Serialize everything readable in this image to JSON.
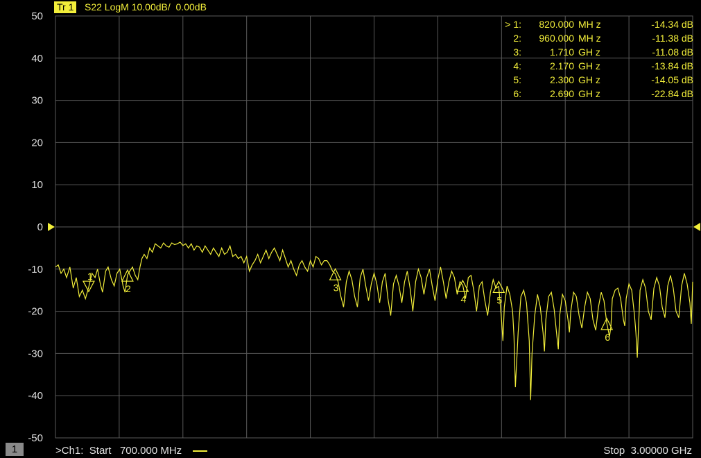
{
  "header": {
    "trace_badge": "Tr 1",
    "trace_title": "S22 LogM 10.00dB/  0.00dB"
  },
  "colors": {
    "trace": "#f2ee3a",
    "grid": "#5a5a5a",
    "background": "#000000",
    "channel_badge": "#8a8a8a"
  },
  "markers": [
    {
      "label": "> 1:",
      "freq": "820.000",
      "unit": "MH z",
      "value": "-14.34 dB",
      "num": "1",
      "x_ghz": 0.82,
      "y_db": -14.34
    },
    {
      "label": "2:",
      "freq": "960.000",
      "unit": "MH z",
      "value": "-11.38 dB",
      "num": "2",
      "x_ghz": 0.96,
      "y_db": -11.38
    },
    {
      "label": "3:",
      "freq": "1.710",
      "unit": "GH z",
      "value": "-11.08 dB",
      "num": "3",
      "x_ghz": 1.71,
      "y_db": -11.08
    },
    {
      "label": "4:",
      "freq": "2.170",
      "unit": "GH z",
      "value": "-13.84 dB",
      "num": "4",
      "x_ghz": 2.17,
      "y_db": -13.84
    },
    {
      "label": "5:",
      "freq": "2.300",
      "unit": "GH z",
      "value": "-14.05 dB",
      "num": "5",
      "x_ghz": 2.3,
      "y_db": -14.05
    },
    {
      "label": "6:",
      "freq": "2.690",
      "unit": "GH z",
      "value": "-22.84 dB",
      "num": "6",
      "x_ghz": 2.69,
      "y_db": -22.84
    }
  ],
  "footer": {
    "channel_number": "1",
    "start_label": ">Ch1:  Start   700.000 MHz",
    "stop_label": "Stop  3.00000 GHz"
  },
  "chart_data": {
    "type": "line",
    "xlim": [
      0.7,
      3.0
    ],
    "ylim": [
      -50,
      50
    ],
    "y_ticks": [
      "50",
      "40",
      "30",
      "20",
      "10",
      "0",
      "-10",
      "-20",
      "-30",
      "-40",
      "-50"
    ],
    "y_tick_values": [
      50,
      40,
      30,
      20,
      10,
      0,
      -10,
      -20,
      -30,
      -40,
      -50
    ],
    "grid": true,
    "reference_level_db": 0,
    "series": [
      {
        "points": [
          [
            0.7,
            -9.5
          ],
          [
            0.71,
            -9.0
          ],
          [
            0.72,
            -11.0
          ],
          [
            0.73,
            -10.0
          ],
          [
            0.74,
            -12.0
          ],
          [
            0.752,
            -9.5
          ],
          [
            0.764,
            -14.5
          ],
          [
            0.775,
            -12.0
          ],
          [
            0.786,
            -16.5
          ],
          [
            0.797,
            -15.0
          ],
          [
            0.808,
            -17.0
          ],
          [
            0.82,
            -14.3
          ],
          [
            0.832,
            -11.0
          ],
          [
            0.843,
            -12.0
          ],
          [
            0.852,
            -10.0
          ],
          [
            0.862,
            -13.5
          ],
          [
            0.87,
            -15.5
          ],
          [
            0.881,
            -10.5
          ],
          [
            0.89,
            -9.5
          ],
          [
            0.902,
            -12.5
          ],
          [
            0.912,
            -14.0
          ],
          [
            0.922,
            -11.0
          ],
          [
            0.932,
            -10.0
          ],
          [
            0.944,
            -14.0
          ],
          [
            0.951,
            -15.5
          ],
          [
            0.96,
            -11.4
          ],
          [
            0.968,
            -10.5
          ],
          [
            0.978,
            -9.5
          ],
          [
            0.988,
            -11.5
          ],
          [
            0.997,
            -12.5
          ],
          [
            1.005,
            -9.5
          ],
          [
            1.012,
            -7.5
          ],
          [
            1.02,
            -6.5
          ],
          [
            1.03,
            -7.5
          ],
          [
            1.04,
            -5.0
          ],
          [
            1.05,
            -6.0
          ],
          [
            1.06,
            -4.0
          ],
          [
            1.07,
            -4.5
          ],
          [
            1.08,
            -5.0
          ],
          [
            1.09,
            -3.8
          ],
          [
            1.1,
            -4.5
          ],
          [
            1.11,
            -4.8
          ],
          [
            1.12,
            -3.8
          ],
          [
            1.13,
            -4.2
          ],
          [
            1.14,
            -4.0
          ],
          [
            1.15,
            -3.6
          ],
          [
            1.16,
            -4.4
          ],
          [
            1.17,
            -4.0
          ],
          [
            1.18,
            -5.0
          ],
          [
            1.19,
            -4.0
          ],
          [
            1.2,
            -5.5
          ],
          [
            1.21,
            -4.5
          ],
          [
            1.22,
            -4.8
          ],
          [
            1.23,
            -6.0
          ],
          [
            1.24,
            -4.5
          ],
          [
            1.25,
            -5.5
          ],
          [
            1.26,
            -6.5
          ],
          [
            1.27,
            -5.0
          ],
          [
            1.28,
            -6.0
          ],
          [
            1.29,
            -7.0
          ],
          [
            1.3,
            -5.0
          ],
          [
            1.31,
            -6.5
          ],
          [
            1.32,
            -6.0
          ],
          [
            1.33,
            -4.5
          ],
          [
            1.34,
            -7.0
          ],
          [
            1.35,
            -6.5
          ],
          [
            1.36,
            -7.5
          ],
          [
            1.37,
            -7.0
          ],
          [
            1.38,
            -8.5
          ],
          [
            1.39,
            -7.0
          ],
          [
            1.4,
            -10.5
          ],
          [
            1.41,
            -9.0
          ],
          [
            1.42,
            -8.0
          ],
          [
            1.43,
            -6.5
          ],
          [
            1.44,
            -8.5
          ],
          [
            1.45,
            -7.0
          ],
          [
            1.46,
            -5.5
          ],
          [
            1.47,
            -7.5
          ],
          [
            1.48,
            -6.0
          ],
          [
            1.49,
            -5.0
          ],
          [
            1.5,
            -6.5
          ],
          [
            1.51,
            -8.0
          ],
          [
            1.52,
            -5.5
          ],
          [
            1.53,
            -7.5
          ],
          [
            1.54,
            -9.5
          ],
          [
            1.55,
            -8.0
          ],
          [
            1.56,
            -10.0
          ],
          [
            1.57,
            -11.5
          ],
          [
            1.58,
            -9.0
          ],
          [
            1.59,
            -8.0
          ],
          [
            1.6,
            -9.5
          ],
          [
            1.61,
            -10.5
          ],
          [
            1.62,
            -8.0
          ],
          [
            1.63,
            -9.5
          ],
          [
            1.64,
            -7.0
          ],
          [
            1.65,
            -7.5
          ],
          [
            1.66,
            -9.0
          ],
          [
            1.67,
            -8.0
          ],
          [
            1.68,
            -8.0
          ],
          [
            1.69,
            -9.0
          ],
          [
            1.7,
            -10.5
          ],
          [
            1.71,
            -11.1
          ],
          [
            1.72,
            -13.0
          ],
          [
            1.73,
            -16.5
          ],
          [
            1.74,
            -19.0
          ],
          [
            1.75,
            -13.0
          ],
          [
            1.76,
            -10.5
          ],
          [
            1.77,
            -12.5
          ],
          [
            1.78,
            -16.5
          ],
          [
            1.79,
            -19.0
          ],
          [
            1.8,
            -12.0
          ],
          [
            1.81,
            -10.0
          ],
          [
            1.82,
            -14.0
          ],
          [
            1.83,
            -17.5
          ],
          [
            1.84,
            -13.5
          ],
          [
            1.85,
            -11.0
          ],
          [
            1.86,
            -13.5
          ],
          [
            1.87,
            -18.0
          ],
          [
            1.88,
            -13.0
          ],
          [
            1.89,
            -11.0
          ],
          [
            1.9,
            -17.0
          ],
          [
            1.91,
            -21.0
          ],
          [
            1.92,
            -13.5
          ],
          [
            1.93,
            -11.5
          ],
          [
            1.94,
            -14.0
          ],
          [
            1.95,
            -18.0
          ],
          [
            1.96,
            -13.0
          ],
          [
            1.97,
            -10.5
          ],
          [
            1.98,
            -14.5
          ],
          [
            1.99,
            -20.0
          ],
          [
            2.0,
            -13.0
          ],
          [
            2.01,
            -10.0
          ],
          [
            2.02,
            -12.0
          ],
          [
            2.03,
            -16.0
          ],
          [
            2.04,
            -12.0
          ],
          [
            2.05,
            -10.0
          ],
          [
            2.06,
            -14.0
          ],
          [
            2.07,
            -17.5
          ],
          [
            2.08,
            -12.5
          ],
          [
            2.09,
            -9.5
          ],
          [
            2.1,
            -13.0
          ],
          [
            2.11,
            -17.0
          ],
          [
            2.12,
            -13.0
          ],
          [
            2.13,
            -10.5
          ],
          [
            2.14,
            -12.0
          ],
          [
            2.15,
            -16.0
          ],
          [
            2.16,
            -13.0
          ],
          [
            2.17,
            -13.8
          ],
          [
            2.18,
            -17.0
          ],
          [
            2.19,
            -12.0
          ],
          [
            2.2,
            -11.5
          ],
          [
            2.21,
            -15.0
          ],
          [
            2.22,
            -20.0
          ],
          [
            2.23,
            -14.0
          ],
          [
            2.24,
            -13.0
          ],
          [
            2.25,
            -17.5
          ],
          [
            2.26,
            -21.0
          ],
          [
            2.27,
            -15.5
          ],
          [
            2.28,
            -12.5
          ],
          [
            2.29,
            -14.5
          ],
          [
            2.3,
            -14.1
          ],
          [
            2.31,
            -22.0
          ],
          [
            2.315,
            -27.0
          ],
          [
            2.32,
            -19.0
          ],
          [
            2.33,
            -14.0
          ],
          [
            2.34,
            -16.0
          ],
          [
            2.35,
            -20.0
          ],
          [
            2.355,
            -26.0
          ],
          [
            2.36,
            -38.0
          ],
          [
            2.37,
            -25.0
          ],
          [
            2.38,
            -16.5
          ],
          [
            2.39,
            -15.0
          ],
          [
            2.4,
            -18.0
          ],
          [
            2.41,
            -27.0
          ],
          [
            2.415,
            -41.0
          ],
          [
            2.42,
            -30.0
          ],
          [
            2.43,
            -21.0
          ],
          [
            2.44,
            -16.0
          ],
          [
            2.45,
            -19.0
          ],
          [
            2.46,
            -25.0
          ],
          [
            2.465,
            -29.5
          ],
          [
            2.47,
            -22.0
          ],
          [
            2.48,
            -16.5
          ],
          [
            2.49,
            -15.5
          ],
          [
            2.5,
            -19.5
          ],
          [
            2.51,
            -26.0
          ],
          [
            2.515,
            -29.0
          ],
          [
            2.52,
            -21.0
          ],
          [
            2.53,
            -16.0
          ],
          [
            2.54,
            -17.5
          ],
          [
            2.55,
            -22.0
          ],
          [
            2.555,
            -25.0
          ],
          [
            2.56,
            -20.0
          ],
          [
            2.57,
            -15.5
          ],
          [
            2.58,
            -16.5
          ],
          [
            2.59,
            -21.0
          ],
          [
            2.6,
            -24.0
          ],
          [
            2.61,
            -19.0
          ],
          [
            2.62,
            -15.5
          ],
          [
            2.63,
            -17.0
          ],
          [
            2.64,
            -22.0
          ],
          [
            2.65,
            -24.5
          ],
          [
            2.66,
            -19.0
          ],
          [
            2.67,
            -15.5
          ],
          [
            2.68,
            -17.5
          ],
          [
            2.69,
            -22.8
          ],
          [
            2.7,
            -26.0
          ],
          [
            2.705,
            -23.5
          ],
          [
            2.71,
            -17.0
          ],
          [
            2.72,
            -15.0
          ],
          [
            2.73,
            -14.5
          ],
          [
            2.74,
            -17.0
          ],
          [
            2.75,
            -22.0
          ],
          [
            2.755,
            -23.5
          ],
          [
            2.76,
            -17.0
          ],
          [
            2.77,
            -13.5
          ],
          [
            2.78,
            -15.0
          ],
          [
            2.79,
            -21.0
          ],
          [
            2.795,
            -25.0
          ],
          [
            2.8,
            -31.0
          ],
          [
            2.805,
            -23.0
          ],
          [
            2.81,
            -15.0
          ],
          [
            2.82,
            -12.5
          ],
          [
            2.83,
            -14.5
          ],
          [
            2.84,
            -20.0
          ],
          [
            2.85,
            -22.0
          ],
          [
            2.86,
            -14.5
          ],
          [
            2.87,
            -12.0
          ],
          [
            2.88,
            -14.0
          ],
          [
            2.89,
            -19.0
          ],
          [
            2.9,
            -21.5
          ],
          [
            2.91,
            -14.0
          ],
          [
            2.92,
            -11.5
          ],
          [
            2.93,
            -14.5
          ],
          [
            2.94,
            -20.0
          ],
          [
            2.95,
            -21.5
          ],
          [
            2.96,
            -14.0
          ],
          [
            2.97,
            -11.0
          ],
          [
            2.98,
            -13.5
          ],
          [
            2.99,
            -18.0
          ],
          [
            2.995,
            -23.0
          ],
          [
            3.0,
            -13.0
          ]
        ]
      }
    ]
  }
}
